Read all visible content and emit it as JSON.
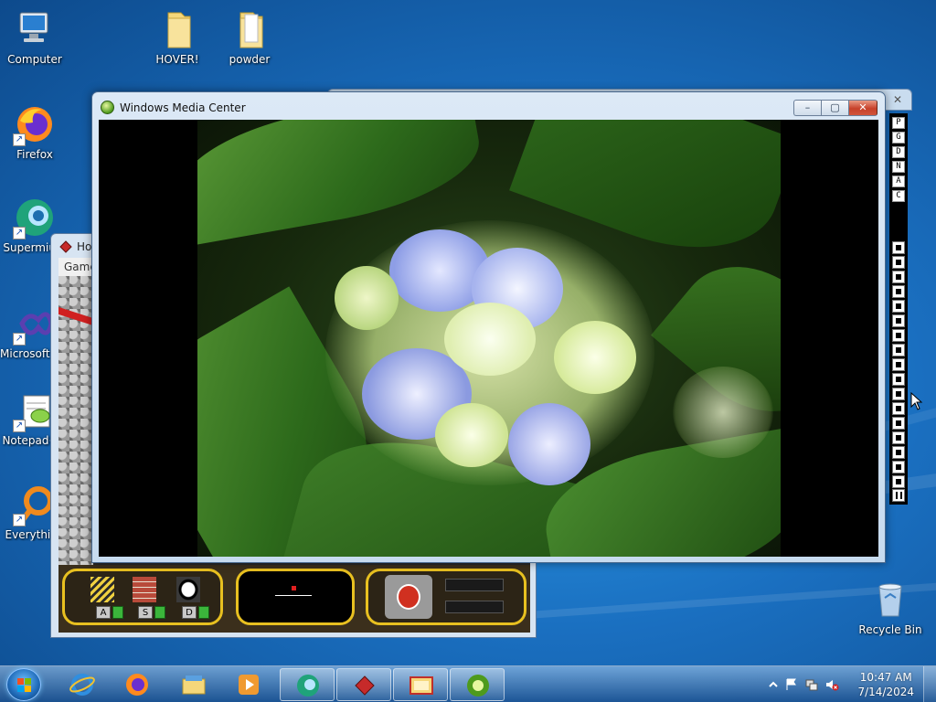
{
  "desktop": {
    "icons": [
      {
        "label": "Computer",
        "icon": "computer-icon"
      },
      {
        "label": "HOVER!",
        "icon": "folder-icon"
      },
      {
        "label": "powder",
        "icon": "folder-icon"
      },
      {
        "label": "Firefox",
        "icon": "firefox-icon"
      },
      {
        "label": "Supermium",
        "icon": "supermium-icon"
      },
      {
        "label": "Microsoft Visual Studio",
        "icon": "visual-studio-icon"
      },
      {
        "label": "Notepad++",
        "icon": "notepad-plus-icon"
      },
      {
        "label": "Everything",
        "icon": "everything-icon"
      },
      {
        "label": "Recycle Bin",
        "icon": "recycle-bin-icon"
      }
    ]
  },
  "game_window": {
    "title": "Ho",
    "menu": "Game",
    "hud_keys": [
      "A",
      "S",
      "D"
    ]
  },
  "wmc_window": {
    "title": "Windows Media Center",
    "minimize": "–",
    "maximize": "▢",
    "close": "✕",
    "content": "Hydrangea photo slideshow"
  },
  "background_window": {
    "close": "✕"
  },
  "side_toolbar": {
    "letters": [
      "P",
      "G",
      "D",
      "N",
      "A",
      "C"
    ],
    "tool_count": 17
  },
  "taskbar": {
    "pinned": [
      {
        "name": "internet-explorer-icon"
      },
      {
        "name": "firefox-icon"
      },
      {
        "name": "file-explorer-icon"
      },
      {
        "name": "media-player-icon"
      },
      {
        "name": "media-center-icon",
        "active": true
      },
      {
        "name": "hover-game-icon",
        "active": true
      },
      {
        "name": "photo-viewer-icon",
        "active": true
      },
      {
        "name": "windows-media-center-icon",
        "active": true
      }
    ],
    "time": "10:47 AM",
    "date": "7/14/2024"
  },
  "colors": {
    "desktop": "#1b74c4",
    "close_button": "#c7412a",
    "hud_border": "#e8c020"
  }
}
